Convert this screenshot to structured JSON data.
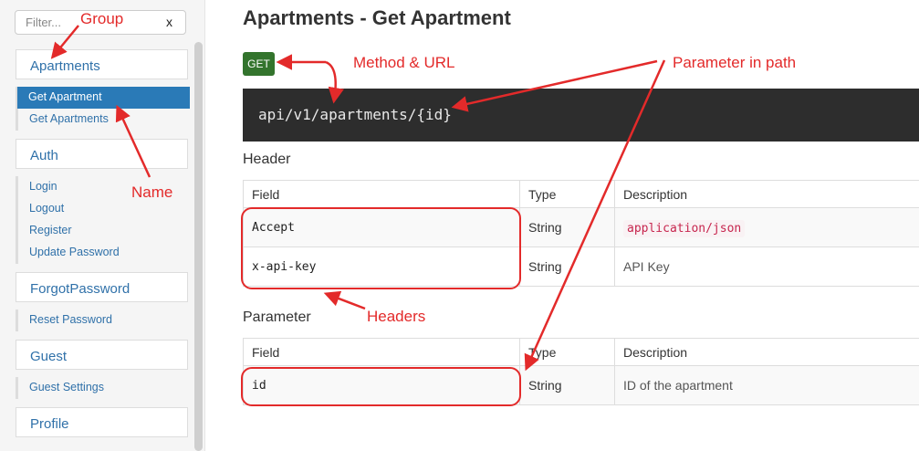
{
  "sidebar": {
    "filter": {
      "placeholder": "Filter...",
      "clear_label": "x"
    },
    "groups": [
      {
        "label": "Apartments",
        "items": [
          {
            "label": "Get Apartment",
            "active": true
          },
          {
            "label": "Get Apartments"
          }
        ]
      },
      {
        "label": "Auth",
        "items": [
          {
            "label": "Login"
          },
          {
            "label": "Logout"
          },
          {
            "label": "Register"
          },
          {
            "label": "Update Password"
          }
        ]
      },
      {
        "label": "ForgotPassword",
        "items": [
          {
            "label": "Reset Password"
          }
        ]
      },
      {
        "label": "Guest",
        "items": [
          {
            "label": "Guest Settings"
          }
        ]
      },
      {
        "label": "Profile",
        "items": []
      }
    ]
  },
  "main": {
    "title": "Apartments - Get Apartment",
    "method": "GET",
    "url": "api/v1/apartments/{id}",
    "header_section": {
      "title": "Header",
      "columns": [
        "Field",
        "Type",
        "Description"
      ],
      "rows": [
        {
          "field": "Accept",
          "type": "String",
          "description": "application/json"
        },
        {
          "field": "x-api-key",
          "type": "String",
          "description": "API Key"
        }
      ]
    },
    "parameter_section": {
      "title": "Parameter",
      "columns": [
        "Field",
        "Type",
        "Description"
      ],
      "rows": [
        {
          "field": "id",
          "type": "String",
          "description": "ID of the apartment"
        }
      ]
    }
  },
  "annotations": {
    "group": "Group",
    "name": "Name",
    "method_url": "Method & URL",
    "parameter_in_path": "Parameter in path",
    "headers": "Headers"
  },
  "colors": {
    "annotation": "#e32a2a",
    "link": "#3071a9",
    "active_item": "#2a7ab7",
    "method_badge": "#33742d",
    "code_block": "#2d2d2d",
    "code_text": "#c7254e"
  }
}
